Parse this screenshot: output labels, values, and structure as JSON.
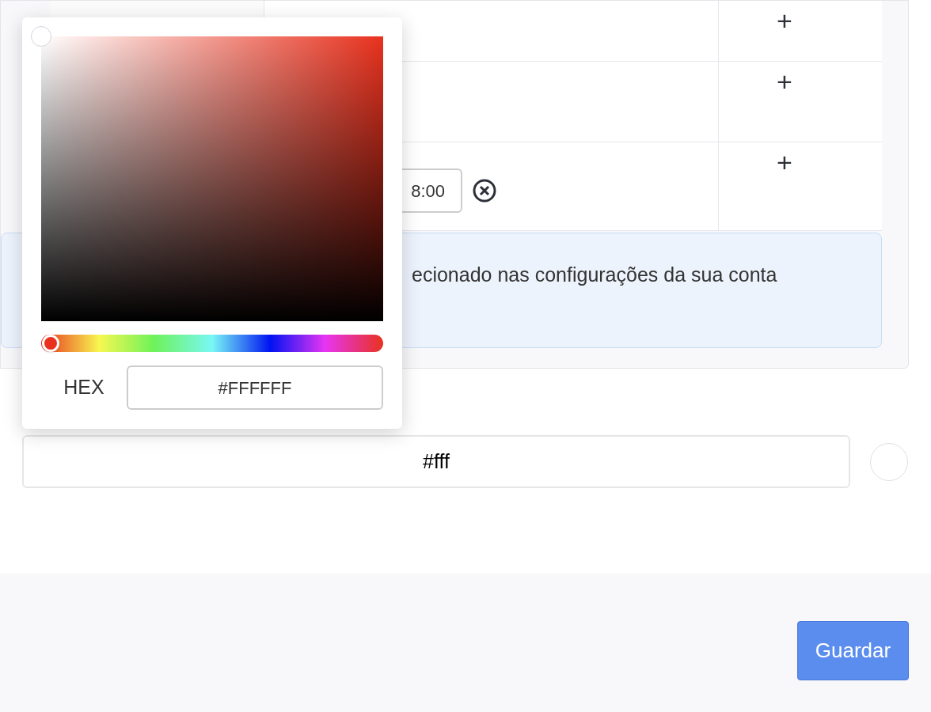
{
  "table": {
    "rows": [
      {
        "kind": "plain",
        "action": "+"
      },
      {
        "kind": "plain",
        "action": "+"
      },
      {
        "kind": "time",
        "time": "8:00",
        "action": "+"
      }
    ]
  },
  "notice": {
    "text": "ecionado nas configurações da sua conta"
  },
  "color_field": {
    "value": "#fff",
    "swatch": {
      "color": "#ffffff"
    }
  },
  "color_picker": {
    "hue": {
      "level": 0
    },
    "hex_label": "HEX",
    "hex_value": "#FFFFFF"
  },
  "footer": {
    "save_button": "Guardar"
  }
}
